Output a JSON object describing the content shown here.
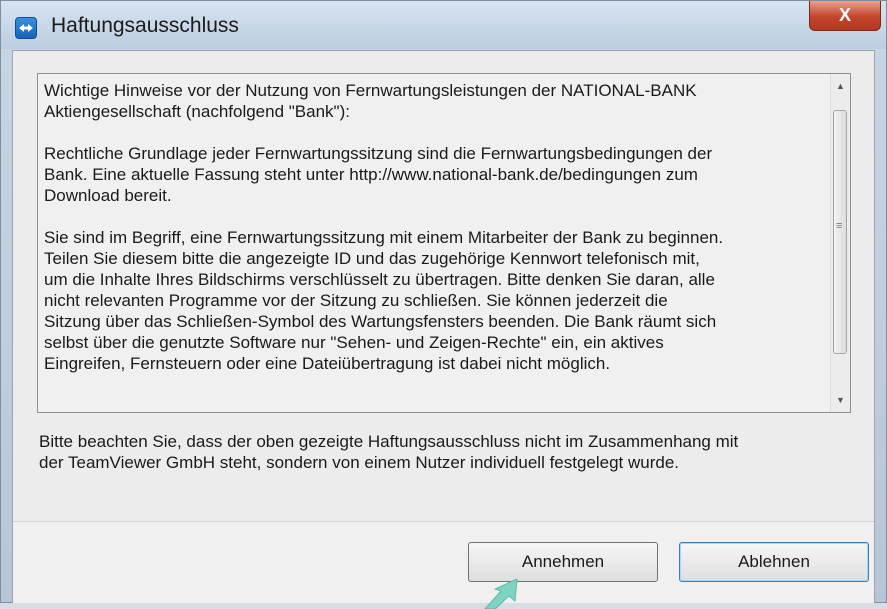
{
  "window": {
    "title": "Haftungsausschluss",
    "close_label": "X"
  },
  "disclaimer": {
    "paragraphs": [
      "Wichtige Hinweise vor der Nutzung von Fernwartungsleistungen der NATIONAL-BANK\nAktiengesellschaft (nachfolgend \"Bank\"):",
      "Rechtliche Grundlage jeder Fernwartungssitzung sind die Fernwartungsbedingungen der\nBank. Eine aktuelle Fassung steht unter http://www.national-bank.de/bedingungen zum\nDownload bereit.",
      "Sie sind im Begriff, eine Fernwartungssitzung mit einem Mitarbeiter der Bank zu beginnen.\nTeilen Sie diesem bitte die angezeigte ID und das zugehörige Kennwort telefonisch mit,\num die Inhalte Ihres Bildschirms verschlüsselt zu übertragen. Bitte denken Sie daran, alle\nnicht relevanten Programme vor der Sitzung zu schließen. Sie können jederzeit die\nSitzung über das Schließen-Symbol des Wartungsfensters beenden. Die Bank räumt sich\nselbst über die genutzte Software nur \"Sehen- und Zeigen-Rechte\" ein, ein aktives\nEingreifen, Fernsteuern oder eine Dateiübertragung ist dabei nicht möglich."
    ]
  },
  "note": "Bitte beachten Sie, dass der oben gezeigte Haftungsausschluss nicht im Zusammenhang mit\nder TeamViewer GmbH steht, sondern von einem Nutzer individuell festgelegt wurde.",
  "buttons": {
    "accept": "Annehmen",
    "decline": "Ablehnen"
  },
  "icons": {
    "app": "teamviewer-icon",
    "close": "close-icon",
    "scroll_up": "scroll-up-arrow-icon",
    "scroll_down": "scroll-down-arrow-icon"
  },
  "colors": {
    "close_button": "#c3452a",
    "default_button_border": "#3c7fb1",
    "annotation_arrow": "#7fd3c1"
  }
}
